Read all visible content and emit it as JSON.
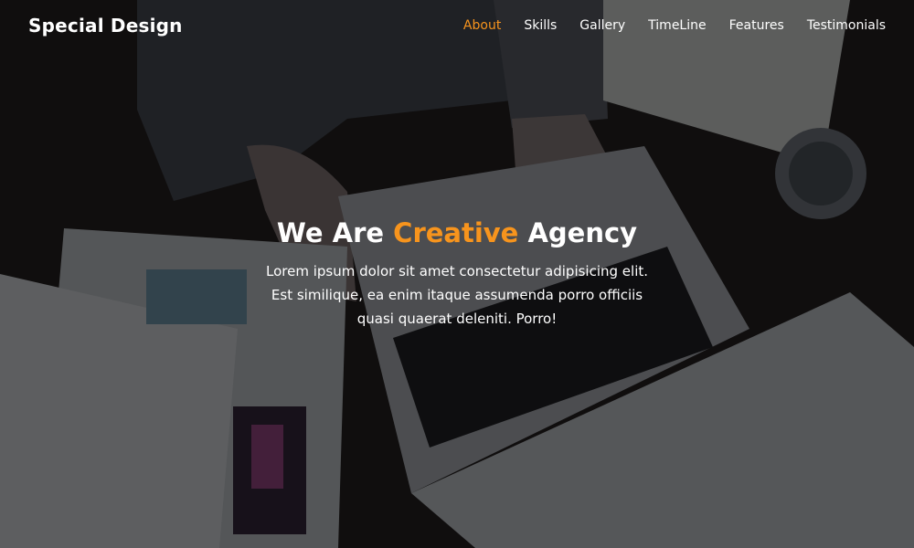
{
  "brand": {
    "logo": "Special Design"
  },
  "nav": {
    "items": [
      {
        "label": "About",
        "active": true
      },
      {
        "label": "Skills",
        "active": false
      },
      {
        "label": "Gallery",
        "active": false
      },
      {
        "label": "TimeLine",
        "active": false
      },
      {
        "label": "Features",
        "active": false
      },
      {
        "label": "Testimonials",
        "active": false
      }
    ]
  },
  "intro": {
    "title_pre": "We Are ",
    "title_accent": "Creative",
    "title_post": " Agency",
    "text": "Lorem ipsum dolor sit amet consectetur adipisicing elit. Est similique, ea enim itaque assumenda porro officiis quasi quaerat deleniti. Porro!"
  },
  "colors": {
    "accent": "#f7941d",
    "text": "#ffffff"
  }
}
